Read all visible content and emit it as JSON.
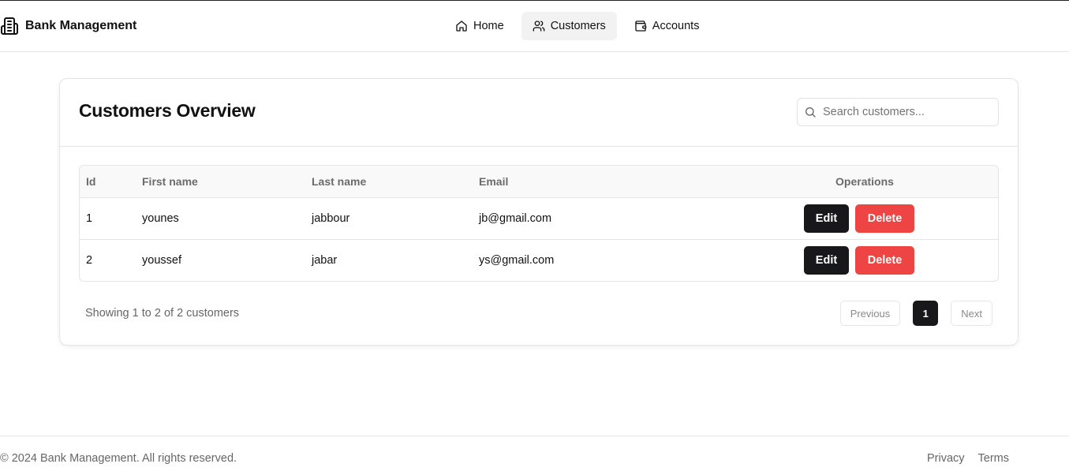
{
  "header": {
    "brand": "Bank Management",
    "brand_icon": "building-icon",
    "nav": [
      {
        "label": "Home",
        "icon": "home-icon"
      },
      {
        "label": "Customers",
        "icon": "users-icon",
        "active": true
      },
      {
        "label": "Accounts",
        "icon": "wallet-icon"
      }
    ]
  },
  "main": {
    "title": "Customers Overview",
    "search": {
      "placeholder": "Search customers...",
      "value": ""
    },
    "table": {
      "columns": [
        "Id",
        "First name",
        "Last name",
        "Email",
        "Operations"
      ],
      "rows": [
        {
          "id": "1",
          "first_name": "younes",
          "last_name": "jabbour",
          "email": "jb@gmail.com"
        },
        {
          "id": "2",
          "first_name": "youssef",
          "last_name": "jabar",
          "email": "ys@gmail.com"
        }
      ],
      "edit_label": "Edit",
      "delete_label": "Delete"
    },
    "summary": "Showing 1 to 2 of 2 customers",
    "pagination": {
      "previous": "Previous",
      "current_page": "1",
      "next": "Next"
    }
  },
  "footer": {
    "copyright": "© 2024 Bank Management. All rights reserved.",
    "links": [
      "Privacy",
      "Terms"
    ]
  },
  "colors": {
    "primary": "#18181b",
    "danger": "#ef4444",
    "muted": "#666666"
  }
}
